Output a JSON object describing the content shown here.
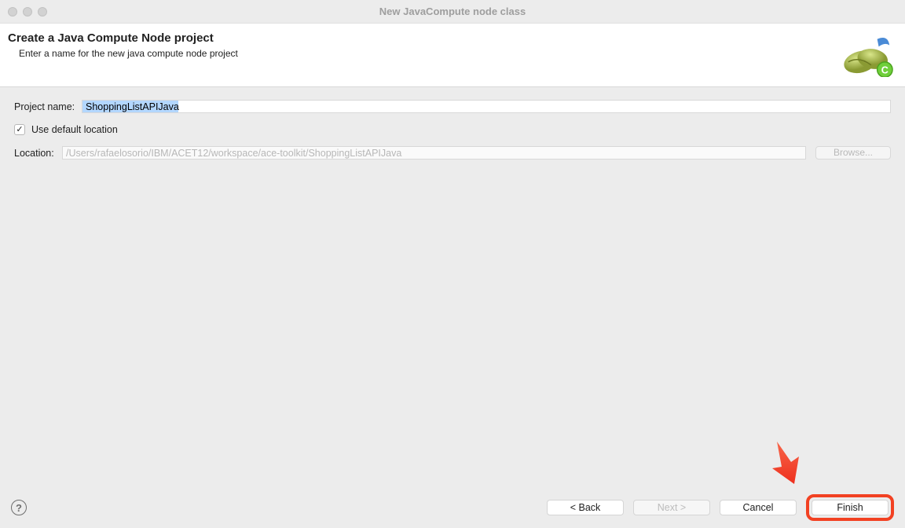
{
  "window_title": "New JavaCompute node class",
  "header": {
    "title": "Create a Java Compute Node project",
    "subtitle": "Enter a name for the new java compute node project"
  },
  "form": {
    "project_name_label": "Project name:",
    "project_name_value": "ShoppingListAPIJava",
    "use_default_label": "Use default location",
    "use_default_checked": true,
    "location_label": "Location:",
    "location_value": "/Users/rafaelosorio/IBM/ACET12/workspace/ace-toolkit/ShoppingListAPIJava",
    "browse_label": "Browse..."
  },
  "footer": {
    "back": "< Back",
    "next": "Next >",
    "cancel": "Cancel",
    "finish": "Finish"
  }
}
